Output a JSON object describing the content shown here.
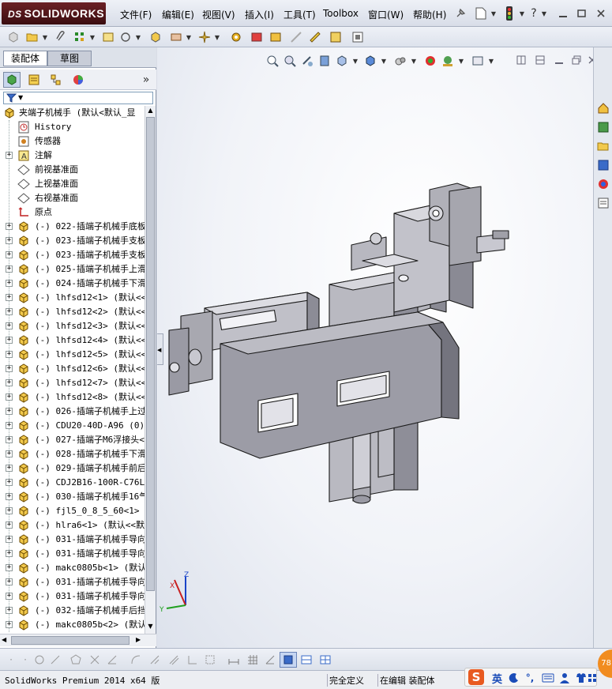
{
  "app": {
    "brand_prefix": "DS",
    "brand_name": "SOLIDWORKS"
  },
  "menu": [
    {
      "label": "文件(F)"
    },
    {
      "label": "编辑(E)"
    },
    {
      "label": "视图(V)"
    },
    {
      "label": "插入(I)"
    },
    {
      "label": "工具(T)"
    },
    {
      "label": "Toolbox"
    },
    {
      "label": "窗口(W)"
    },
    {
      "label": "帮助(H)"
    }
  ],
  "top_controls": {
    "help": "?"
  },
  "feature_tabs": [
    {
      "label": "装配体",
      "active": true
    },
    {
      "label": "草图",
      "active": false
    }
  ],
  "panel_expand": "»",
  "tree": {
    "root": "夹端子机械手  (默认<默认_显",
    "items": [
      {
        "label": "History",
        "icon": "history-icon",
        "expand": false
      },
      {
        "label": "传感器",
        "icon": "sensor-icon",
        "expand": false
      },
      {
        "label": "注解",
        "icon": "annotation-icon",
        "expand": true
      },
      {
        "label": "前视基准面",
        "icon": "plane-icon",
        "expand": false
      },
      {
        "label": "上视基准面",
        "icon": "plane-icon",
        "expand": false
      },
      {
        "label": "右视基准面",
        "icon": "plane-icon",
        "expand": false
      },
      {
        "label": "原点",
        "icon": "origin-icon",
        "expand": false
      },
      {
        "label": "(-) 022-插端子机械手底板",
        "icon": "part-icon",
        "expand": true
      },
      {
        "label": "(-) 023-插端子机械手支板",
        "icon": "part-icon",
        "expand": true
      },
      {
        "label": "(-) 023-插端子机械手支板",
        "icon": "part-icon",
        "expand": true
      },
      {
        "label": "(-) 025-插端子机械手上滑",
        "icon": "part-icon",
        "expand": true
      },
      {
        "label": "(-) 024-插端子机械手下滑",
        "icon": "part-icon",
        "expand": true
      },
      {
        "label": "(-) lhfsd12<1> (默认<<默",
        "icon": "part-icon",
        "expand": true
      },
      {
        "label": "(-) lhfsd12<2> (默认<<默",
        "icon": "part-icon",
        "expand": true
      },
      {
        "label": "(-) lhfsd12<3> (默认<<默",
        "icon": "part-icon",
        "expand": true
      },
      {
        "label": "(-) lhfsd12<4> (默认<<默",
        "icon": "part-icon",
        "expand": true
      },
      {
        "label": "(-) lhfsd12<5> (默认<<默",
        "icon": "part-icon",
        "expand": true
      },
      {
        "label": "(-) lhfsd12<6> (默认<<默",
        "icon": "part-icon",
        "expand": true
      },
      {
        "label": "(-) lhfsd12<7> (默认<<默",
        "icon": "part-icon",
        "expand": true
      },
      {
        "label": "(-) lhfsd12<8> (默认<<默",
        "icon": "part-icon",
        "expand": true
      },
      {
        "label": "(-) 026-插端子机械手上过",
        "icon": "part-icon",
        "expand": true
      },
      {
        "label": "(-) CDU20-40D-A96 (0)<1",
        "icon": "part-icon",
        "expand": true
      },
      {
        "label": "(-) 027-插端子M6浮接头<",
        "icon": "part-icon",
        "expand": true
      },
      {
        "label": "(-) 028-插端子机械手下滑",
        "icon": "part-icon",
        "expand": true
      },
      {
        "label": "(-) 029-插端子机械手前后",
        "icon": "part-icon",
        "expand": true
      },
      {
        "label": "(-) CDJ2B16-100R-C76L(0",
        "icon": "part-icon",
        "expand": true
      },
      {
        "label": "(-) 030-插端子机械手16气",
        "icon": "part-icon",
        "expand": true
      },
      {
        "label": "(-) fjl5_0_8_5_60<1> (默",
        "icon": "part-icon",
        "expand": true
      },
      {
        "label": "(-) hlra6<1> (默认<<默认",
        "icon": "part-icon",
        "expand": true
      },
      {
        "label": "(-) 031-插端子机械手导向",
        "icon": "part-icon",
        "expand": true
      },
      {
        "label": "(-) 031-插端子机械手导向",
        "icon": "part-icon",
        "expand": true
      },
      {
        "label": "(-) makc0805b<1> (默认<<",
        "icon": "part-icon",
        "expand": true
      },
      {
        "label": "(-) 031-插端子机械手导向",
        "icon": "part-icon",
        "expand": true
      },
      {
        "label": "(-) 031-插端子机械手导向",
        "icon": "part-icon",
        "expand": true
      },
      {
        "label": "(-) 032-插端子机械手后挡",
        "icon": "part-icon",
        "expand": true
      },
      {
        "label": "(-) makc0805b<2> (默认<<",
        "icon": "part-icon",
        "expand": true
      }
    ]
  },
  "triad": {
    "x": "X",
    "y": "Y",
    "z": "Z"
  },
  "status": {
    "product": "SolidWorks Premium 2014 x64 版",
    "definition": "完全定义",
    "mode": "在编辑 装配体"
  },
  "ime": {
    "logo": "S",
    "lang": "英"
  },
  "badge": {
    "text": "78"
  },
  "colors": {
    "accent": "#6b2126",
    "tree_selection": "#316ac5",
    "model_face": "#9c9ca6",
    "model_edge": "#1a1a1a",
    "ime_orange": "#f18c20"
  }
}
